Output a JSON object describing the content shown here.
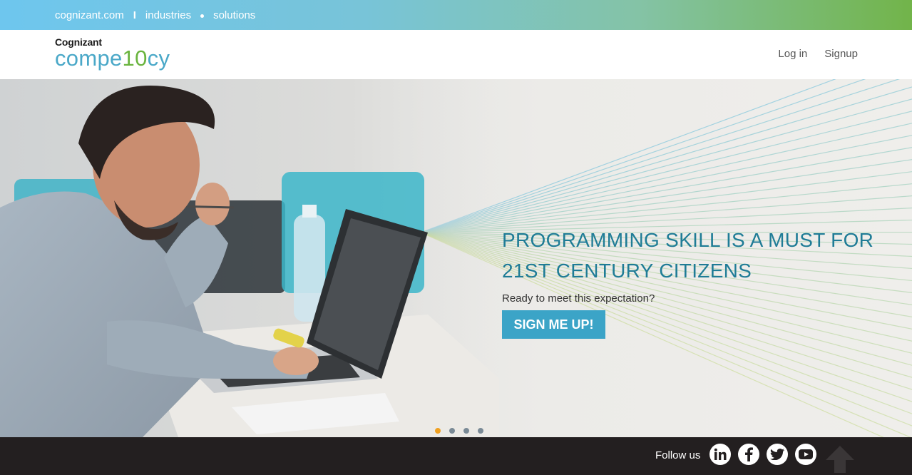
{
  "topbar": {
    "links": [
      "cognizant.com",
      "industries",
      "solutions"
    ]
  },
  "header": {
    "brand": "Cognizant",
    "product_prefix": "compe",
    "product_accent": "10",
    "product_suffix": "cy",
    "nav": {
      "login": "Log in",
      "signup": "Signup"
    }
  },
  "hero": {
    "title_line1": "PROGRAMMING SKILL IS A MUST FOR",
    "title_line2": "21ST CENTURY CITIZENS",
    "subtitle": "Ready to meet this expectation?",
    "cta": "SIGN ME UP!",
    "slides": {
      "count": 4,
      "active": 1
    }
  },
  "footer": {
    "follow_label": "Follow us",
    "social": [
      "linkedin-icon",
      "facebook-icon",
      "twitter-icon",
      "youtube-icon"
    ],
    "scroll_top": "arrow-up-icon"
  },
  "colors": {
    "brand_blue": "#4aa8c8",
    "brand_green": "#6ab43e",
    "title_teal": "#1f7c96",
    "cta_blue": "#3ba4c7",
    "footer_bg": "#231f20",
    "dot_active": "#f0a020"
  }
}
